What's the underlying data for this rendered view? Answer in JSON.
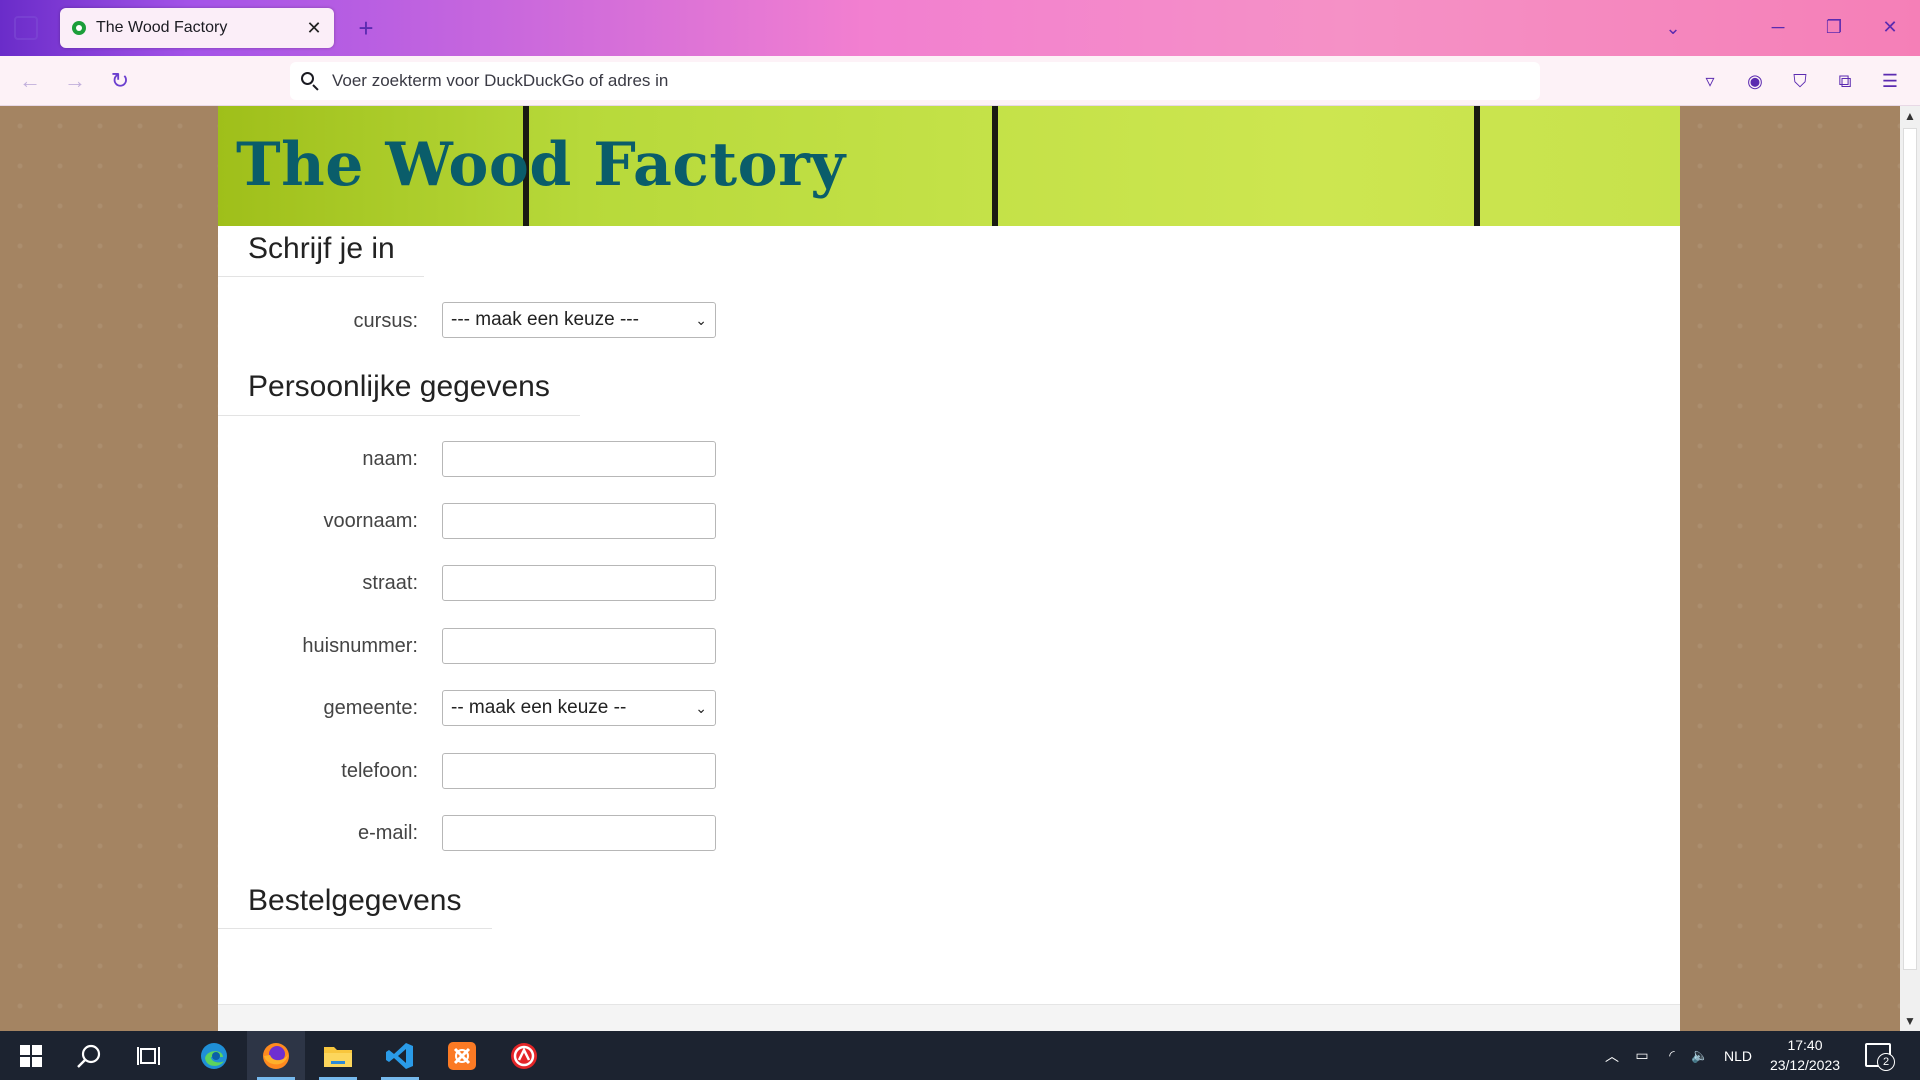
{
  "browser": {
    "tab_title": "The Wood Factory",
    "url_placeholder": "Voer zoekterm voor DuckDuckGo of adres in"
  },
  "page": {
    "site_title": "The Wood Factory",
    "sections": {
      "enroll": "Schrijf je in",
      "personal": "Persoonlijke gegevens",
      "order": "Bestelgegevens"
    },
    "form": {
      "cursus_label": "cursus:",
      "cursus_value": "--- maak een keuze ---",
      "naam_label": "naam:",
      "voornaam_label": "voornaam:",
      "straat_label": "straat:",
      "huisnummer_label": "huisnummer:",
      "gemeente_label": "gemeente:",
      "gemeente_value": "-- maak een keuze --",
      "telefoon_label": "telefoon:",
      "email_label": "e-mail:"
    }
  },
  "taskbar": {
    "language": "NLD",
    "time": "17:40",
    "date": "23/12/2023",
    "notification_count": "2"
  },
  "colors": {
    "banner_title": "#0a5d6a",
    "page_background": "#a48462",
    "taskbar": "#1c2330"
  }
}
